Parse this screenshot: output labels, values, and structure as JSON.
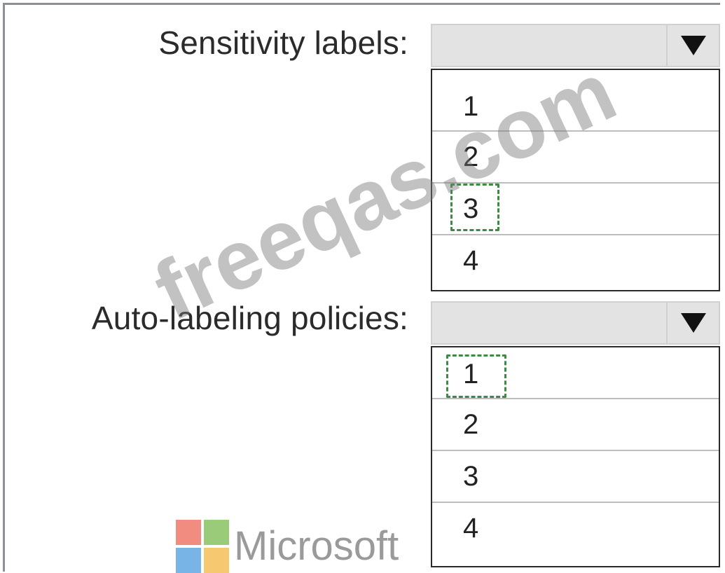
{
  "sensitivity": {
    "label": "Sensitivity labels:",
    "selected": "",
    "options": [
      "1",
      "2",
      "3",
      "4"
    ],
    "highlighted_option": "3"
  },
  "auto_labeling": {
    "label": "Auto-labeling policies:",
    "selected": "",
    "options": [
      "1",
      "2",
      "3",
      "4"
    ],
    "highlighted_option": "1"
  },
  "watermark": "freeqas.com",
  "logo": {
    "text": "Microsoft",
    "colors": [
      "#f08c80",
      "#9acb78",
      "#78b4e6",
      "#f6c870"
    ]
  },
  "colors": {
    "highlight_dash": "#3e8a44",
    "select_bg": "#e3e3e3"
  }
}
